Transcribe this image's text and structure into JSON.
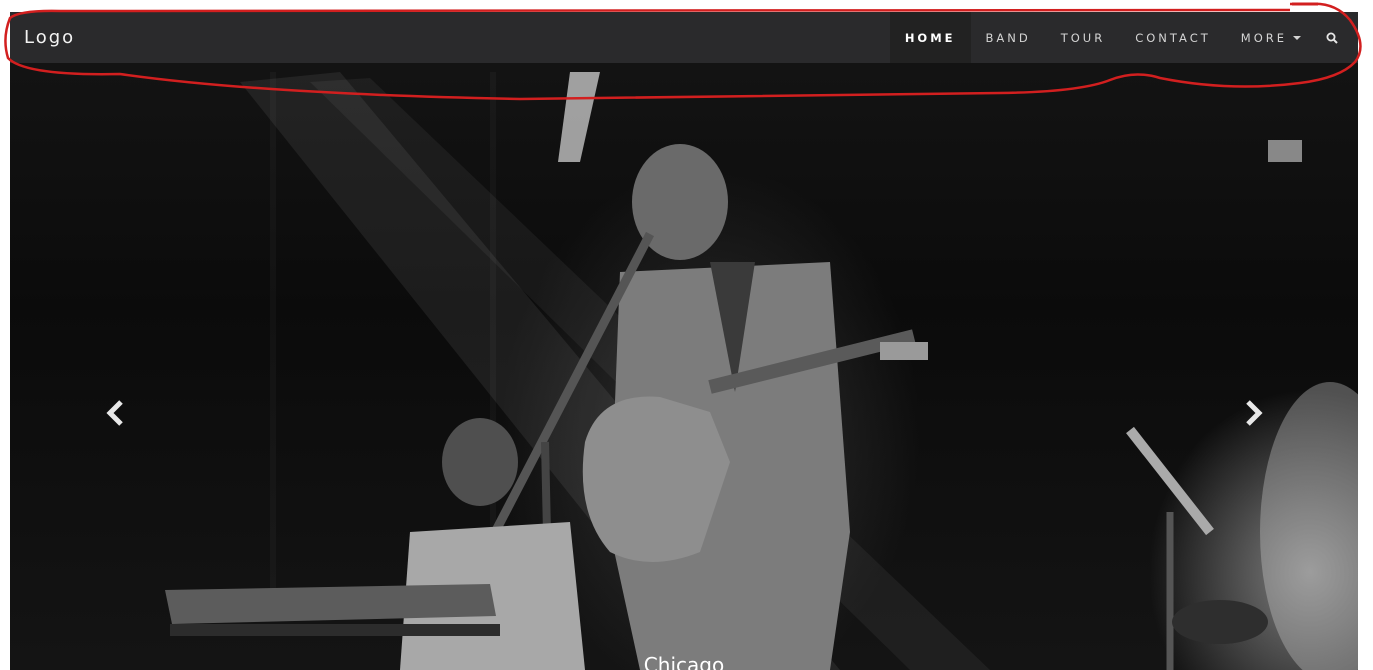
{
  "navbar": {
    "brand": "Logo",
    "items": [
      {
        "label": "HOME",
        "active": true
      },
      {
        "label": "BAND"
      },
      {
        "label": "TOUR"
      },
      {
        "label": "CONTACT"
      },
      {
        "label": "MORE"
      }
    ],
    "search_icon": "search-icon"
  },
  "carousel": {
    "prev_icon": "chevron-left-icon",
    "next_icon": "chevron-right-icon",
    "caption": "Chicago"
  },
  "colors": {
    "navbar_bg": "#2a2a2c",
    "active_item_bg": "#222222",
    "annotation": "#d21f1f"
  }
}
